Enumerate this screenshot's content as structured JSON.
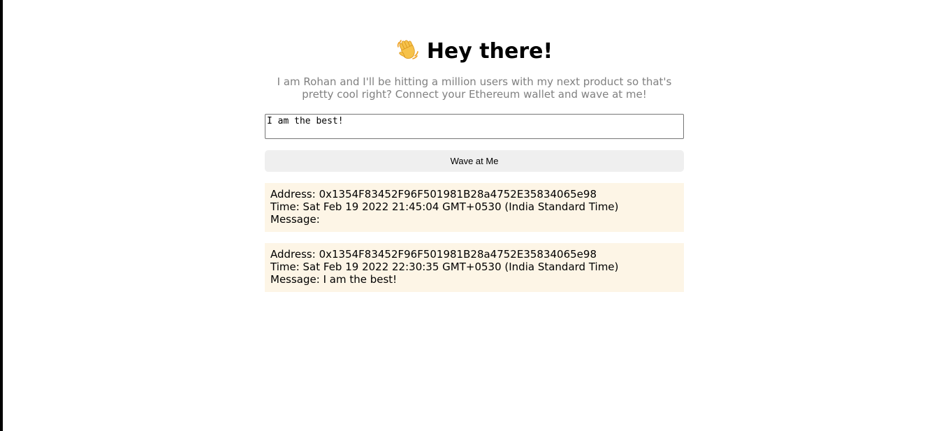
{
  "header": {
    "emoji_icon": "waving-hand-icon",
    "title": "Hey there!"
  },
  "bio": "I am Rohan and I'll be hitting a million users with my next product so that's pretty cool right? Connect your Ethereum wallet and wave at me!",
  "message_input": {
    "value": "I am the best!"
  },
  "wave_button": {
    "label": "Wave at Me"
  },
  "waves": [
    {
      "address_label": "Address: ",
      "address": "0x1354F83452F96F501981B28a4752E35834065e98",
      "time_label": "Time: ",
      "time": "Sat Feb 19 2022 21:45:04 GMT+0530 (India Standard Time)",
      "message_label": "Message: ",
      "message": ""
    },
    {
      "address_label": "Address: ",
      "address": "0x1354F83452F96F501981B28a4752E35834065e98",
      "time_label": "Time: ",
      "time": "Sat Feb 19 2022 22:30:35 GMT+0530 (India Standard Time)",
      "message_label": "Message: ",
      "message": "I am the best!"
    }
  ],
  "colors": {
    "card_background": "#fdf5e6",
    "bio_text": "#808080",
    "button_background": "#efefef",
    "emoji_yellow": "#f6c24a"
  }
}
